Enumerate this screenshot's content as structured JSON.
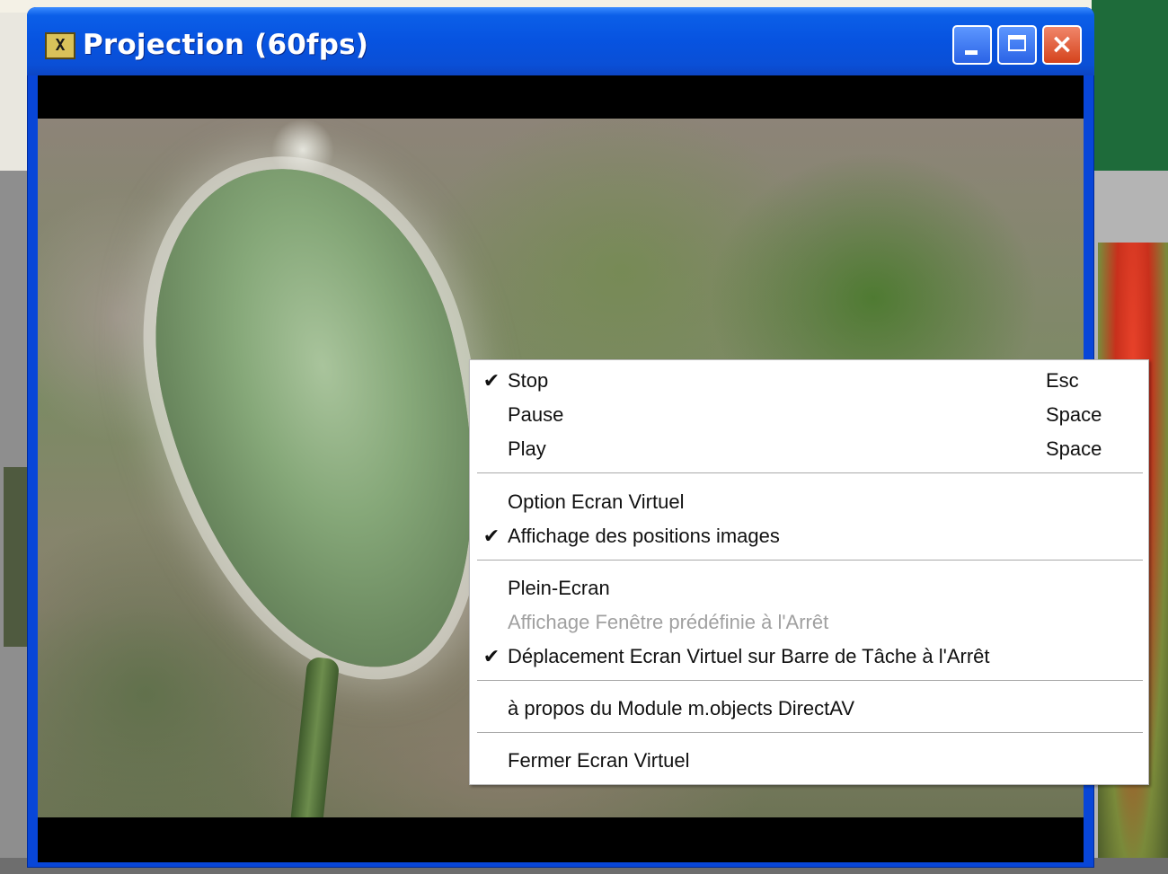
{
  "window": {
    "title": "Projection (60fps)",
    "icon": "app-icon",
    "controls": {
      "minimize": "minimize-icon",
      "maximize": "maximize-icon",
      "close": "close-icon",
      "close_glyph": "×"
    }
  },
  "context_menu": {
    "check_glyph": "✔",
    "items": [
      {
        "label": "Stop",
        "shortcut": "Esc",
        "checked": true,
        "enabled": true
      },
      {
        "label": "Pause",
        "shortcut": "Space",
        "checked": false,
        "enabled": true
      },
      {
        "label": "Play",
        "shortcut": "Space",
        "checked": false,
        "enabled": true
      },
      {
        "label": "Option Ecran Virtuel",
        "shortcut": "",
        "checked": false,
        "enabled": true
      },
      {
        "label": "Affichage des positions images",
        "shortcut": "",
        "checked": true,
        "enabled": true
      },
      {
        "label": "Plein-Ecran",
        "shortcut": "",
        "checked": false,
        "enabled": true
      },
      {
        "label": "Affichage Fenêtre prédéfinie à l'Arrêt",
        "shortcut": "",
        "checked": false,
        "enabled": false
      },
      {
        "label": "Déplacement Ecran Virtuel sur Barre de Tâche à l'Arrêt",
        "shortcut": "",
        "checked": true,
        "enabled": true
      },
      {
        "label": "à propos du Module m.objects DirectAV",
        "shortcut": "",
        "checked": false,
        "enabled": true
      },
      {
        "label": "Fermer Ecran Virtuel",
        "shortcut": "",
        "checked": false,
        "enabled": true
      }
    ]
  }
}
